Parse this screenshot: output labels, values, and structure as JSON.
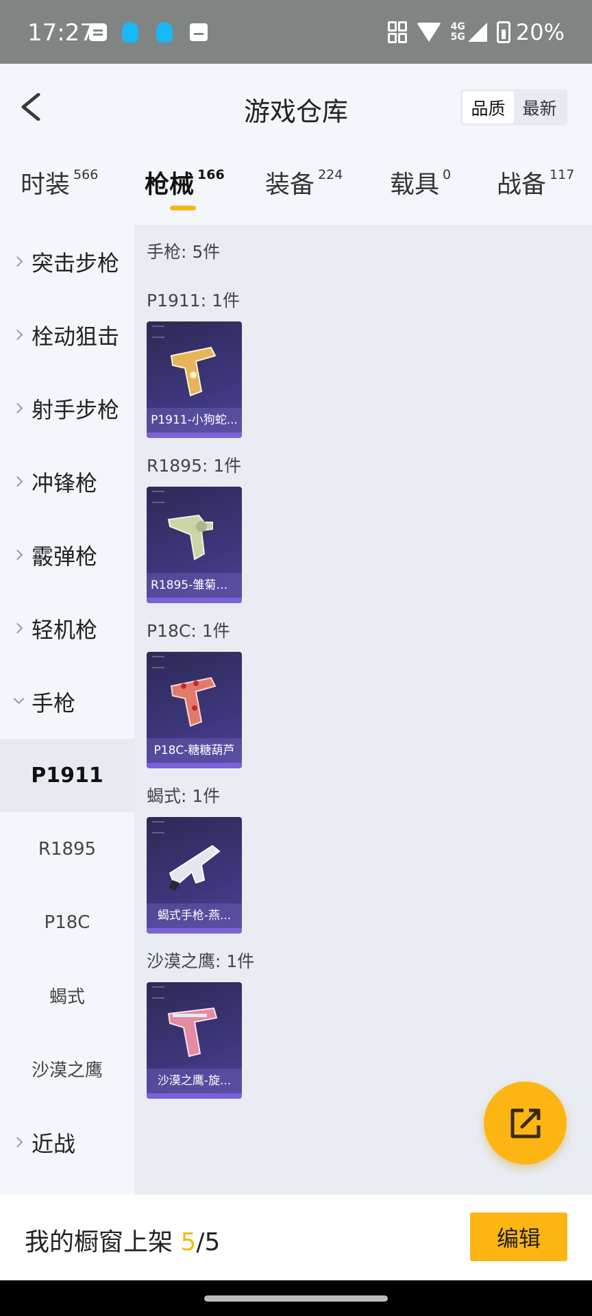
{
  "status_bar": {
    "time": "17:27",
    "network": [
      "4G",
      "5G"
    ],
    "battery": "20%"
  },
  "header": {
    "title": "游戏仓库",
    "sort_options": [
      "品质",
      "最新"
    ],
    "active_sort": "品质"
  },
  "tabs": [
    {
      "label": "时装",
      "count": "566"
    },
    {
      "label": "枪械",
      "count": "166",
      "active": true
    },
    {
      "label": "装备",
      "count": "224"
    },
    {
      "label": "载具",
      "count": "0"
    },
    {
      "label": "战备",
      "count": "117"
    }
  ],
  "sidebar": {
    "categories": [
      "突击步枪",
      "栓动狙击",
      "射手步枪",
      "冲锋枪",
      "霰弹枪",
      "轻机枪",
      "手枪",
      "近战"
    ],
    "expanded": "手枪",
    "subitems": [
      "P1911",
      "R1895",
      "P18C",
      "蝎式",
      "沙漠之鹰"
    ],
    "active_subitem": "P1911"
  },
  "content": {
    "summary": "手枪: 5件",
    "groups": [
      {
        "heading": "P1911: 1件",
        "item": "P1911-小狗蛇...",
        "art": "pistol-gold"
      },
      {
        "heading": "R1895: 1件",
        "item": "R1895-雏菊兔...",
        "art": "revolver-green"
      },
      {
        "heading": "P18C: 1件",
        "item": "P18C-糖糖葫芦",
        "art": "pistol-red"
      },
      {
        "heading": "蝎式: 1件",
        "item": "蝎式手枪-燕...",
        "art": "smg-silver"
      },
      {
        "heading": "沙漠之鹰: 1件",
        "item": "沙漠之鹰-旋...",
        "art": "pistol-pink"
      }
    ]
  },
  "bottom": {
    "showcase_label": "我的橱窗上架 ",
    "showcase_count": "5",
    "showcase_total": "/5",
    "edit_label": "编辑"
  },
  "colors": {
    "accent": "#fdb514",
    "card_bg": "#3c3579",
    "selected_row": "#e7ebf1"
  },
  "icons": [
    "back-arrow-icon",
    "share-out-icon",
    "chevron-right-icon",
    "chevron-down-icon"
  ]
}
